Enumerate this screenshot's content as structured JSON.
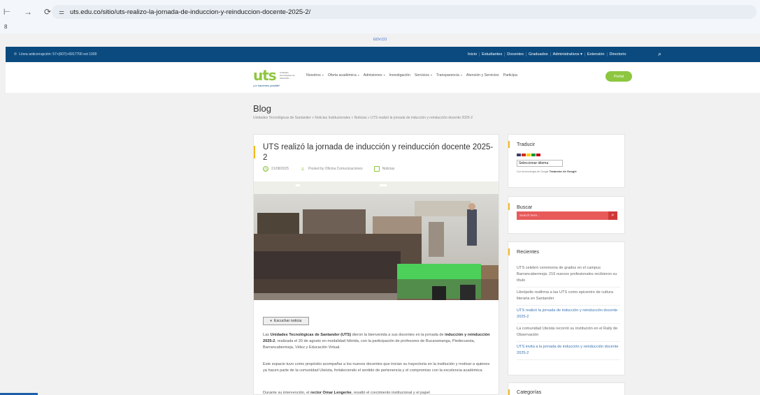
{
  "browser": {
    "url": "uts.edu.co/sitio/uts-realizo-la-jornada-de-induccion-y-reinduccion-docente-2025-2/",
    "bookmark_glyph": "8"
  },
  "site": {
    "govco": "GOV.CO",
    "phone": "Línea anticorrupción: 57+(607)+6917700 ext 1000",
    "top_links": [
      "Inicio",
      "Estudiantes",
      "Docentes",
      "Graduados",
      "Administrativos ▾",
      "Extensión",
      "Directorio"
    ],
    "logo_text": "uts",
    "logo_sub": "Unidades Tecnológicas de Santander",
    "logo_slogan": "¡Lo hacemos posible!",
    "menu": [
      {
        "label": "Nosotros",
        "caret": true
      },
      {
        "label": "Oferta académica",
        "caret": true
      },
      {
        "label": "Admisiones",
        "caret": true
      },
      {
        "label": "Investigación",
        "caret": false
      },
      {
        "label": "Servicios",
        "caret": true
      },
      {
        "label": "Transparencia",
        "caret": true
      },
      {
        "label": "Atención y Servicios",
        "caret": false
      },
      {
        "label": "Participa",
        "caret": false
      }
    ],
    "portal_label": "Portal"
  },
  "page": {
    "section_title": "Blog",
    "breadcrumb": "Unidades Tecnológicas de Santander » Noticias Institucionales » Noticias » UTS realizó la jornada de inducción y reinducción docente 2025-2"
  },
  "article": {
    "title": "UTS realizó la jornada de inducción y reinducción docente 2025-2",
    "date": "21/08/2025",
    "author": "Posted by Oficina Comunicaciones",
    "category": "Noticias",
    "listen_label": "Escuchar noticia",
    "p1_pre": "Las ",
    "p1_bold1": "Unidades Tecnológicas de Santander (UTS)",
    "p1_mid": " dieron la bienvenida a sus docentes en la jornada de ",
    "p1_bold2": "inducción y reinducción 2025-2",
    "p1_post": ", realizada el 20 de agosto en modalidad híbrida, con la participación de profesores de Bucaramanga, Piedecuesta, Barrancabermeja, Vélez y Educación Virtual.",
    "p2": "Este espacio tuvo como propósito acompañar a los nuevos docentes que inician su trayectoria en la institución y motivar a quienes ya hacen parte de la comunidad Uteísta, fortaleciendo el sentido de pertenencia y el compromiso con la excelencia académica.",
    "p3_pre": "Durante su intervención, el ",
    "p3_bold": "rector Omar Lengerke",
    "p3_post": ", resaltó el crecimiento institucional y el papel"
  },
  "sidebar": {
    "translate_title": "Traducir",
    "lang_select": "Seleccionar idioma",
    "powered_pre": "Con la tecnología de Google",
    "powered_bold": "Traductor de Google",
    "search_title": "Buscar",
    "search_placeholder": "Search here...",
    "recent_title": "Recientes",
    "recent": [
      {
        "text": "UTS celebró ceremonia de grados en el campus Barrancabermeja: 216 nuevos profesionales recibieron su título",
        "active": false
      },
      {
        "text": "Librópolis reafirma a las UTS como epicentro de cultura literaria en Santander",
        "active": false
      },
      {
        "text": "UTS realizó la jornada de inducción y reinducción docente 2025-2",
        "active": true
      },
      {
        "text": "La comunidad Uteísta recorrió su institución en el Rally de Observación",
        "active": false
      },
      {
        "text": "UTS invita a la jornada de inducción y reinducción docente 2025-2",
        "active": true
      }
    ],
    "categories_title": "Categorías"
  }
}
